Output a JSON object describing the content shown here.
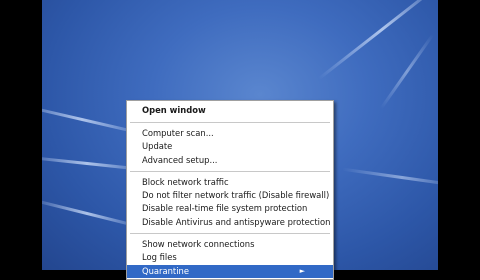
{
  "menu": {
    "open_window": "Open window",
    "group1": [
      "Computer scan...",
      "Update",
      "Advanced setup..."
    ],
    "group2": [
      "Block network traffic",
      "Do not filter network traffic (Disable firewall)",
      "Disable real-time file system protection",
      "Disable Antivirus and antispyware protection"
    ],
    "group3": [
      "Show network connections",
      "Log files"
    ],
    "highlighted_item": "Quarantine",
    "submenu_arrow": "arrow-right-icon"
  },
  "colors": {
    "desktop": "#3f6cbf",
    "highlight": "#3169c6",
    "menu_bg": "#ffffff"
  }
}
